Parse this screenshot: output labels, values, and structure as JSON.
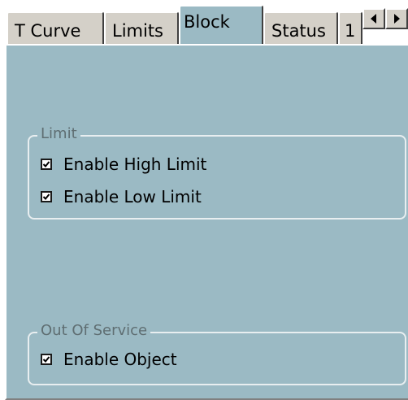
{
  "tabs": [
    {
      "label": "T Curve",
      "active": false
    },
    {
      "label": "Limits",
      "active": false
    },
    {
      "label": "Block",
      "active": true
    },
    {
      "label": "Status",
      "active": false
    },
    {
      "label": "1",
      "active": false
    }
  ],
  "scroll": {
    "left_icon": "arrow-left-icon",
    "right_icon": "arrow-right-icon"
  },
  "groups": {
    "limit": {
      "title": "Limit",
      "items": [
        {
          "label": "Enable High Limit",
          "checked": true
        },
        {
          "label": "Enable Low Limit",
          "checked": true
        }
      ]
    },
    "out_of_service": {
      "title": "Out Of Service",
      "items": [
        {
          "label": "Enable Object",
          "checked": true
        }
      ]
    }
  },
  "colors": {
    "panel_bg": "#9bbac4",
    "tab_bg": "#d4d0c8",
    "legend_text": "#5f6e72"
  }
}
